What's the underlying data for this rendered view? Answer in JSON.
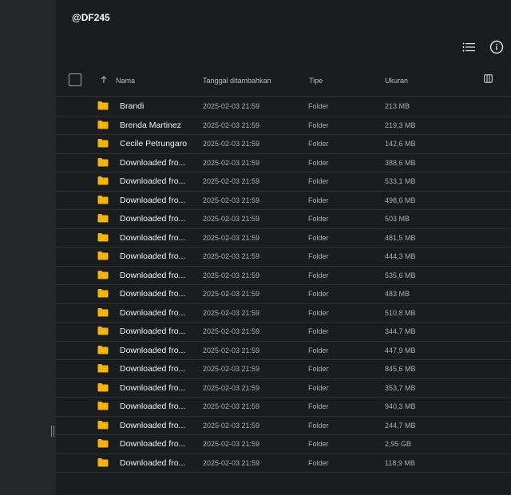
{
  "title": "@DF245",
  "icons": {
    "list_view": "list-view-icon",
    "info": "info-icon",
    "columns": "columns-icon",
    "sort": "arrow-up-icon",
    "folder": "folder-icon"
  },
  "colors": {
    "folder": "#f2b414",
    "background": "#1b1c1d",
    "sidebar": "#25272a"
  },
  "columns": {
    "name": "Nama",
    "date": "Tanggal ditambahkan",
    "type": "Tipe",
    "size": "Ukuran"
  },
  "rows": [
    {
      "name": "Brandi",
      "date": "2025-02-03 21:59",
      "type": "Folder",
      "size": "213 MB"
    },
    {
      "name": "Brenda Martinez",
      "date": "2025-02-03 21:59",
      "type": "Folder",
      "size": "219,3 MB"
    },
    {
      "name": "Cecile Petrungaro",
      "date": "2025-02-03 21:59",
      "type": "Folder",
      "size": "142,6 MB"
    },
    {
      "name": "Downloaded fro...",
      "date": "2025-02-03 21:59",
      "type": "Folder",
      "size": "388,6 MB"
    },
    {
      "name": "Downloaded fro...",
      "date": "2025-02-03 21:59",
      "type": "Folder",
      "size": "533,1 MB"
    },
    {
      "name": "Downloaded fro...",
      "date": "2025-02-03 21:59",
      "type": "Folder",
      "size": "498,6 MB"
    },
    {
      "name": "Downloaded fro...",
      "date": "2025-02-03 21:59",
      "type": "Folder",
      "size": "503 MB"
    },
    {
      "name": "Downloaded fro...",
      "date": "2025-02-03 21:59",
      "type": "Folder",
      "size": "481,5 MB"
    },
    {
      "name": "Downloaded fro...",
      "date": "2025-02-03 21:59",
      "type": "Folder",
      "size": "444,3 MB"
    },
    {
      "name": "Downloaded fro...",
      "date": "2025-02-03 21:59",
      "type": "Folder",
      "size": "535,6 MB"
    },
    {
      "name": "Downloaded fro...",
      "date": "2025-02-03 21:59",
      "type": "Folder",
      "size": "483 MB"
    },
    {
      "name": "Downloaded fro...",
      "date": "2025-02-03 21:59",
      "type": "Folder",
      "size": "510,8 MB"
    },
    {
      "name": "Downloaded fro...",
      "date": "2025-02-03 21:59",
      "type": "Folder",
      "size": "344,7 MB"
    },
    {
      "name": "Downloaded fro...",
      "date": "2025-02-03 21:59",
      "type": "Folder",
      "size": "447,9 MB"
    },
    {
      "name": "Downloaded fro...",
      "date": "2025-02-03 21:59",
      "type": "Folder",
      "size": "845,6 MB"
    },
    {
      "name": "Downloaded fro...",
      "date": "2025-02-03 21:59",
      "type": "Folder",
      "size": "353,7 MB"
    },
    {
      "name": "Downloaded fro...",
      "date": "2025-02-03 21:59",
      "type": "Folder",
      "size": "940,3 MB"
    },
    {
      "name": "Downloaded fro...",
      "date": "2025-02-03 21:59",
      "type": "Folder",
      "size": "244,7 MB"
    },
    {
      "name": "Downloaded fro...",
      "date": "2025-02-03 21:59",
      "type": "Folder",
      "size": "2,95 GB"
    },
    {
      "name": "Downloaded fro...",
      "date": "2025-02-03 21:59",
      "type": "Folder",
      "size": "118,9 MB"
    }
  ]
}
